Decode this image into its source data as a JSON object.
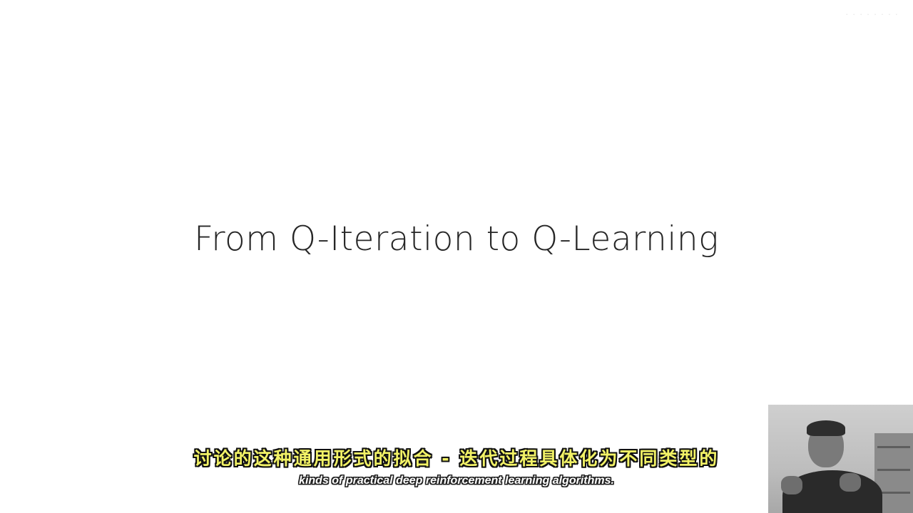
{
  "slide": {
    "title": "From Q-Iteration to Q-Learning",
    "watermark": "· · · · · · · ·"
  },
  "captions": {
    "chinese": "讨论的这种通用形式的拟合 - 迭代过程具体化为不同类型的",
    "english": "kinds of practical deep reinforcement learning algorithms."
  },
  "colors": {
    "background": "#ffffff",
    "title_text": "#262626",
    "caption_zh": "#f2f266",
    "caption_en": "#ffffff"
  },
  "icons": {
    "webcam": "presenter-webcam-video"
  }
}
